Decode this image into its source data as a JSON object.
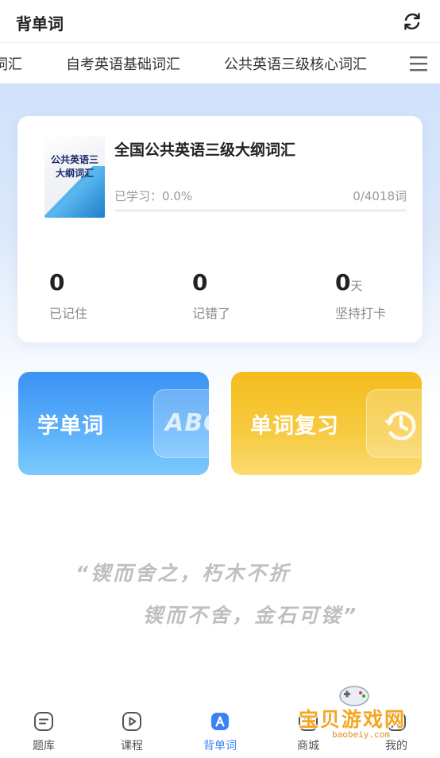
{
  "header": {
    "title": "背单词"
  },
  "tabs": [
    {
      "label": "词汇"
    },
    {
      "label": "自考英语基础词汇"
    },
    {
      "label": "公共英语三级核心词汇"
    }
  ],
  "book": {
    "cover_line1": "公共英语三",
    "cover_line2": "大纲词汇",
    "title": "全国公共英语三级大纲词汇",
    "progress_label": "已学习：0.0%",
    "progress_fraction": 0.0,
    "progress_count": "0/4018词"
  },
  "stats": [
    {
      "value": "0",
      "unit": "",
      "label": "已记住"
    },
    {
      "value": "0",
      "unit": "",
      "label": "记错了"
    },
    {
      "value": "0",
      "unit": "天",
      "label": "坚持打卡"
    }
  ],
  "actions": {
    "learn_label": "学单词",
    "learn_badge": "ABC",
    "review_label": "单词复习"
  },
  "quote": {
    "line1": "“锲而舍之，朽木不折",
    "line2": "锲而不舍，金石可镂”"
  },
  "nav": [
    {
      "label": "题库",
      "icon": "question-bank-icon"
    },
    {
      "label": "课程",
      "icon": "course-play-icon"
    },
    {
      "label": "背单词",
      "icon": "vocabulary-icon",
      "active": true
    },
    {
      "label": "商城",
      "icon": "shop-icon"
    },
    {
      "label": "我的",
      "icon": "profile-icon"
    }
  ],
  "watermark": {
    "text": "宝贝游戏网",
    "sub": "baobeiy.com"
  },
  "colors": {
    "accent": "#3b82f6",
    "learn": "#3a93f4",
    "review": "#f4bd1d"
  }
}
